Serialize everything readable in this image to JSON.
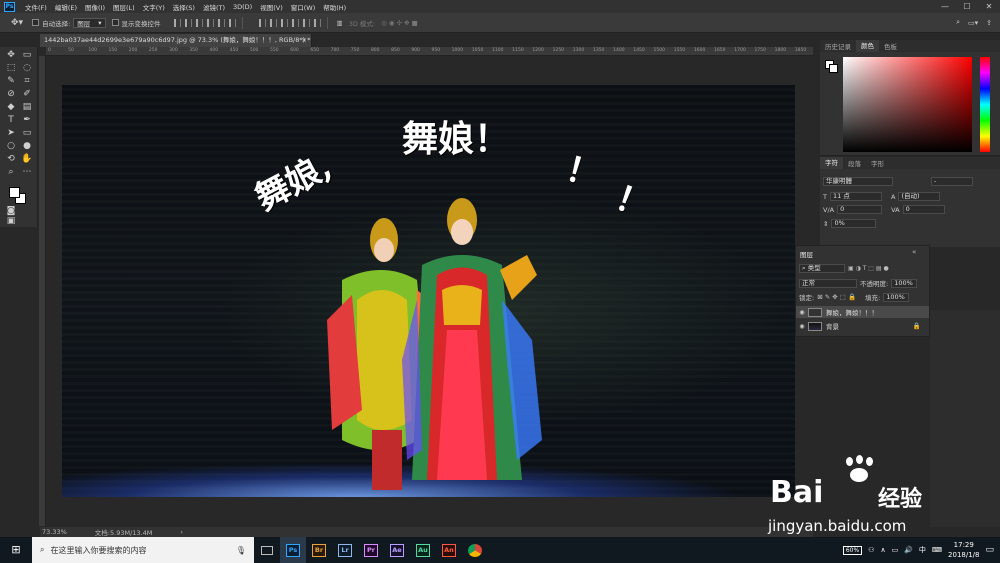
{
  "menu": {
    "app_icon": "Ps",
    "items": [
      "文件(F)",
      "编辑(E)",
      "图像(I)",
      "图层(L)",
      "文字(Y)",
      "选择(S)",
      "滤镜(T)",
      "3D(D)",
      "视图(V)",
      "窗口(W)",
      "帮助(H)"
    ]
  },
  "options": {
    "auto_select_label": "自动选择:",
    "auto_select_value": "图层",
    "show_transform_label": "显示变换控件",
    "mode_3d_label": "3D 模式:"
  },
  "document": {
    "tab_title": "1442ba037ae44d2699e3e679a90c6d97.jpg @ 73.3% (舞娘，舞娘！！！, RGB/8*) *",
    "ruler_ticks": [
      "0",
      "50",
      "100",
      "150",
      "200",
      "250",
      "300",
      "350",
      "400",
      "450",
      "500",
      "550",
      "600",
      "650",
      "700",
      "750",
      "800",
      "850",
      "900",
      "950",
      "1000",
      "1050",
      "1100",
      "1150",
      "1200",
      "1250",
      "1300",
      "1350",
      "1400",
      "1450",
      "1500",
      "1550",
      "1600",
      "1650",
      "1700",
      "1750",
      "1800",
      "1850"
    ],
    "canvas_text": {
      "left": "舞娘,",
      "middle": "舞娘！",
      "right1": "！",
      "right2": "！"
    },
    "zoom": "73.33%",
    "doc_size": "文档:5.93M/13.4M"
  },
  "color_panel": {
    "tabs": [
      "历史记录",
      "颜色",
      "色板"
    ],
    "active_tab": "颜色"
  },
  "character_panel": {
    "tabs": [
      "字符",
      "段落",
      "字形"
    ],
    "font_family": "华康明體",
    "font_style": "-",
    "font_size": "11 点",
    "leading": "(自动)",
    "kerning": "0",
    "tracking": "0",
    "scale": "0%"
  },
  "layers_panel": {
    "title": "图层",
    "filter_kind": "类型",
    "blend_mode": "正常",
    "opacity_label": "不透明度:",
    "opacity_value": "100%",
    "lock_label": "锁定:",
    "fill_label": "填充:",
    "fill_value": "100%",
    "layers": [
      {
        "name": "舞娘，舞娘！！！",
        "type": "text"
      },
      {
        "name": "背景",
        "type": "image"
      }
    ]
  },
  "taskbar": {
    "search_placeholder": "在这里输入你要搜索的内容",
    "apps": [
      {
        "label": "Ps",
        "color": "#31a8ff"
      },
      {
        "label": "Br",
        "color": "#e8a33d"
      },
      {
        "label": "Lr",
        "color": "#8fb8e8"
      },
      {
        "label": "Pr",
        "color": "#d98cff"
      },
      {
        "label": "Ae",
        "color": "#b8a0ff"
      },
      {
        "label": "Au",
        "color": "#54d9a0"
      },
      {
        "label": "An",
        "color": "#ff5a3c"
      }
    ],
    "battery": "60%",
    "ime": "中",
    "time": "17:29",
    "date": "2018/1/8"
  },
  "watermark": {
    "brand": "Bai",
    "brand_cn": "经验",
    "url": "jingyan.baidu.com"
  }
}
